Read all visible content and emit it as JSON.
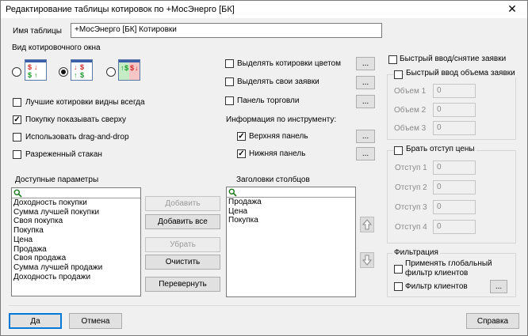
{
  "window": {
    "title": "Редактирование таблицы котировок по +МосЭнерго [БК]",
    "close_glyph": "✕"
  },
  "table_name": {
    "label": "Имя таблицы",
    "value": "+МосЭнерго [БК] Котировки"
  },
  "view": {
    "caption": "Вид котировочного окна",
    "options": [
      {
        "label": "вариант 1",
        "selected": false
      },
      {
        "label": "вариант 2",
        "selected": true
      },
      {
        "label": "вариант 3",
        "selected": false
      }
    ],
    "icon_glyphs": {
      "dollar": "$",
      "up": "↑",
      "down": "↓"
    }
  },
  "left_checks": [
    {
      "label": "Лучшие котировки видны всегда",
      "checked": false
    },
    {
      "label": "Покупку показывать сверху",
      "checked": true
    },
    {
      "label": "Использовать drag-and-drop",
      "checked": false
    },
    {
      "label": "Разреженный стакан",
      "checked": false
    }
  ],
  "mid_checks": [
    {
      "label": "Выделять котировки цветом",
      "checked": false
    },
    {
      "label": "Выделять свои заявки",
      "checked": false
    },
    {
      "label": "Панель торговли",
      "checked": false
    }
  ],
  "instrument_info": {
    "label": "Информация по инструменту:",
    "items": [
      {
        "label": "Верхняя панель",
        "checked": true
      },
      {
        "label": "Нижняя панель",
        "checked": true
      }
    ]
  },
  "ellipsis": "...",
  "available": {
    "label": "Доступные параметры",
    "items": [
      "Доходность покупки",
      "Сумма лучшей покупки",
      "Своя покупка",
      "Покупка",
      "Цена",
      "Продажа",
      "Своя продажа",
      "Сумма лучшей продажи",
      "Доходность продажи"
    ]
  },
  "middle_buttons": {
    "add": "Добавить",
    "add_all": "Добавить все",
    "remove": "Убрать",
    "clear": "Очистить",
    "reverse": "Перевернуть"
  },
  "headers": {
    "label": "Заголовки столбцов",
    "items": [
      "Продажа",
      "Цена",
      "Покупка"
    ]
  },
  "quick": {
    "label": "Быстрый ввод/снятие заявки",
    "checked": false,
    "volume": {
      "caption": "Быстрый ввод объема заявки",
      "checked": false,
      "fields": [
        {
          "label": "Объем 1",
          "value": "0"
        },
        {
          "label": "Объем 2",
          "value": "0"
        },
        {
          "label": "Объем 3",
          "value": "0"
        }
      ]
    },
    "offset": {
      "caption": "Брать отступ цены",
      "checked": false,
      "fields": [
        {
          "label": "Отступ 1",
          "value": "0"
        },
        {
          "label": "Отступ 2",
          "value": "0"
        },
        {
          "label": "Отступ 3",
          "value": "0"
        },
        {
          "label": "Отступ 4",
          "value": "0"
        }
      ]
    }
  },
  "filter": {
    "caption": "Фильтрация",
    "global_label_1": "Применять глобальный",
    "global_label_2": "фильтр клиентов",
    "global_checked": false,
    "clients_label": "Фильтр клиентов",
    "clients_checked": false
  },
  "footer": {
    "ok": "Да",
    "cancel": "Отмена",
    "help": "Справка"
  },
  "colors": {
    "accent": "#0078d7",
    "buy_green": "#1a9a2a",
    "sell_red": "#d42a2a",
    "view_header": "#3a5fa8"
  }
}
